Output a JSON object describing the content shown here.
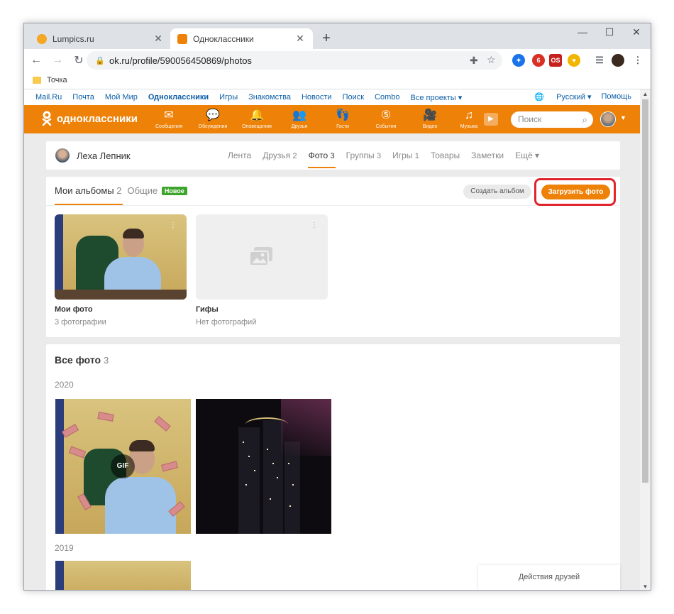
{
  "browser": {
    "tabs": [
      {
        "title": "Lumpics.ru",
        "active": false,
        "favicon_color": "#f5a623"
      },
      {
        "title": "Одноклассники",
        "active": true,
        "favicon_color": "#ee8208"
      }
    ],
    "new_tab_label": "+",
    "window_controls": {
      "minimize": "—",
      "maximize": "☐",
      "close": "✕"
    },
    "url": "ok.ru/profile/590056450869/photos",
    "bookmarks": [
      {
        "label": "Точка"
      }
    ],
    "extensions": [
      {
        "name": "vpn-extension-icon",
        "color": "#1a73e8",
        "text": "✦"
      },
      {
        "name": "adblock-extension-icon",
        "color": "#d93025",
        "text": "6"
      },
      {
        "name": "os-extension-icon",
        "color": "#c5221f",
        "text": "OS"
      },
      {
        "name": "shield-extension-icon",
        "color": "#f2b600",
        "text": "♥"
      }
    ]
  },
  "portal": {
    "links": [
      "Mail.Ru",
      "Почта",
      "Мой Мир",
      "Одноклассники",
      "Игры",
      "Знакомства",
      "Новости",
      "Поиск",
      "Combo",
      "Все проекты ▾"
    ],
    "bold_link": "Одноклассники",
    "language": "Русский ▾",
    "help": "Помощь"
  },
  "header": {
    "logo_text": "одноклассники",
    "nav": [
      {
        "label": "Сообщения",
        "icon": "messages-icon",
        "glyph": "✉"
      },
      {
        "label": "Обсуждения",
        "icon": "discussions-icon",
        "glyph": "💬"
      },
      {
        "label": "Оповещения",
        "icon": "notifications-icon",
        "glyph": "🔔"
      },
      {
        "label": "Друзья",
        "icon": "friends-icon",
        "glyph": "👥"
      },
      {
        "label": "Гости",
        "icon": "guests-icon",
        "glyph": "👣"
      },
      {
        "label": "События",
        "icon": "events-icon",
        "glyph": "⑤"
      },
      {
        "label": "Видео",
        "icon": "video-icon",
        "glyph": "🎥"
      },
      {
        "label": "Музыка",
        "icon": "music-icon",
        "glyph": "♫"
      }
    ],
    "search_placeholder": "Поиск",
    "accent_color": "#ee8208"
  },
  "profile": {
    "name": "Леха Лепник",
    "tabs": [
      {
        "label": "Лента",
        "count": ""
      },
      {
        "label": "Друзья",
        "count": "2"
      },
      {
        "label": "Фото",
        "count": "3",
        "active": true
      },
      {
        "label": "Группы",
        "count": "3"
      },
      {
        "label": "Игры",
        "count": "1"
      },
      {
        "label": "Товары",
        "count": ""
      },
      {
        "label": "Заметки",
        "count": ""
      },
      {
        "label": "Ещё ▾",
        "count": ""
      }
    ]
  },
  "albums_section": {
    "tab_my": "Мои альбомы",
    "tab_my_count": "2",
    "tab_shared": "Общие",
    "badge_new": "Новое",
    "create_button": "Создать альбом",
    "upload_button": "Загрузить фото",
    "albums": [
      {
        "name": "Мои фото",
        "count": "3 фотографии"
      },
      {
        "name": "Гифы",
        "count": "Нет фотографий"
      }
    ]
  },
  "all_photos": {
    "title": "Все фото",
    "count": "3",
    "years": [
      "2020",
      "2019"
    ],
    "gif_label": "GIF"
  },
  "friends_actions": "Действия друзей"
}
